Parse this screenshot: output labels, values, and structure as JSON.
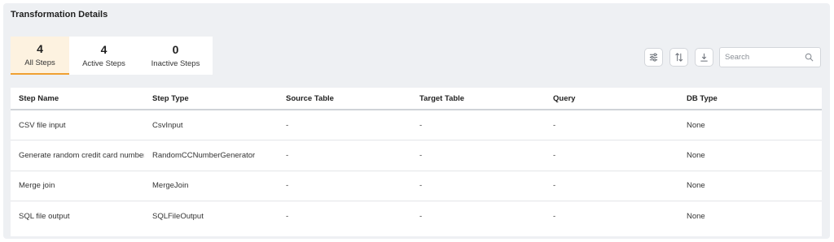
{
  "panel": {
    "title": "Transformation Details"
  },
  "tabs": [
    {
      "count": "4",
      "label": "All Steps",
      "active": true
    },
    {
      "count": "4",
      "label": "Active Steps",
      "active": false
    },
    {
      "count": "0",
      "label": "Inactive Steps",
      "active": false
    }
  ],
  "toolbar": {
    "filter_icon": "sliders-icon",
    "sort_icon": "sort-arrows-icon",
    "download_icon": "download-icon",
    "search_placeholder": "Search",
    "search_icon": "search-icon"
  },
  "colors": {
    "accent": "#f0a032",
    "active_tab_bg": "#fdf2e0",
    "panel_bg": "#eef0f3"
  },
  "table": {
    "columns": [
      "Step Name",
      "Step Type",
      "Source Table",
      "Target Table",
      "Query",
      "DB Type"
    ],
    "rows": [
      [
        "CSV file input",
        "CsvInput",
        "-",
        "-",
        "-",
        "None"
      ],
      [
        "Generate random credit card numbers",
        "RandomCCNumberGenerator",
        "-",
        "-",
        "-",
        "None"
      ],
      [
        "Merge join",
        "MergeJoin",
        "-",
        "-",
        "-",
        "None"
      ],
      [
        "SQL file output",
        "SQLFileOutput",
        "-",
        "-",
        "-",
        "None"
      ]
    ]
  }
}
